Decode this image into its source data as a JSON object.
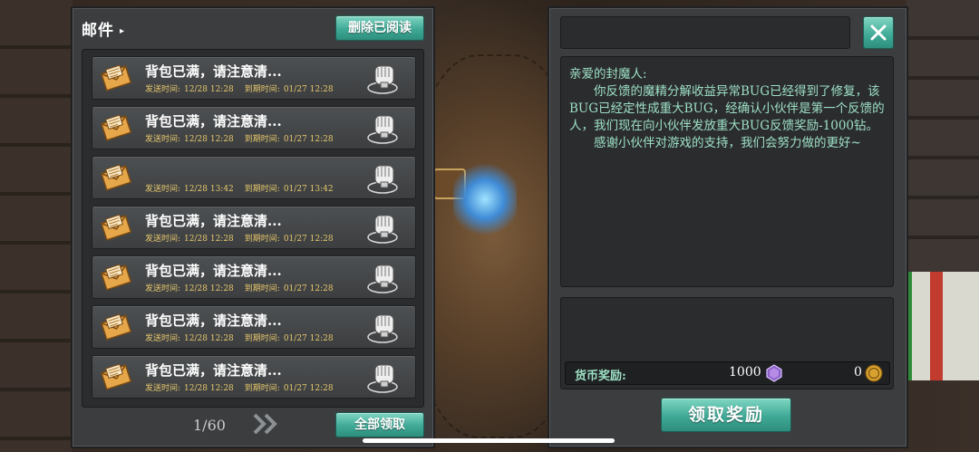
{
  "mail_panel": {
    "title": "邮件",
    "delete_read_label": "删除已阅读",
    "claim_all_label": "全部领取",
    "page_indicator": "1/60",
    "sent_label": "发送时间:",
    "expire_label": "到期时间:",
    "items": [
      {
        "subject": "背包已满，请注意清...",
        "sent": "12/28 12:28",
        "expire": "01/27 12:28"
      },
      {
        "subject": "背包已满，请注意清...",
        "sent": "12/28 12:28",
        "expire": "01/27 12:28"
      },
      {
        "subject": "",
        "sent": "12/28 13:42",
        "expire": "01/27 13:42"
      },
      {
        "subject": "背包已满，请注意清...",
        "sent": "12/28 12:28",
        "expire": "01/27 12:28"
      },
      {
        "subject": "背包已满，请注意清...",
        "sent": "12/28 12:28",
        "expire": "01/27 12:28"
      },
      {
        "subject": "背包已满，请注意清...",
        "sent": "12/28 12:28",
        "expire": "01/27 12:28"
      },
      {
        "subject": "背包已满，请注意清...",
        "sent": "12/28 12:28",
        "expire": "01/27 12:28"
      }
    ]
  },
  "detail_panel": {
    "sender": "",
    "greeting": "亲爱的封魔人:",
    "paragraph1": "你反馈的魔精分解收益异常BUG已经得到了修复，该BUG已经定性成重大BUG，经确认小伙伴是第一个反馈的人，我们现在向小伙伴发放重大BUG反馈奖励-1000钻。",
    "paragraph2": "感谢小伙伴对游戏的支持，我们会努力做的更好~",
    "currency_label": "货币奖励:",
    "diamond_amount": "1000",
    "coin_amount": "0",
    "claim_label": "领取奖励"
  },
  "colors": {
    "accent_teal": "#3fa996",
    "letter_text": "#9de0c5",
    "meta_text": "#e8c86c"
  },
  "icons": [
    "envelope-icon",
    "claim-hand-icon",
    "double-chevron-right-icon",
    "close-icon",
    "diamond-icon",
    "gold-coin-icon"
  ]
}
